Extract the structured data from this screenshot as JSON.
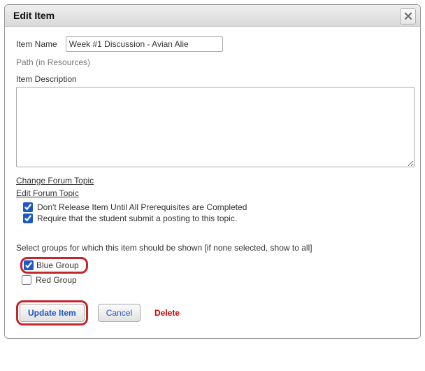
{
  "dialog": {
    "title": "Edit Item"
  },
  "form": {
    "item_name": {
      "label": "Item Name",
      "value": "Week #1 Discussion - Avian Alie"
    },
    "path_label": "Path (in Resources)",
    "description": {
      "label": "Item Description",
      "value": ""
    }
  },
  "links": {
    "change_forum": "Change Forum Topic",
    "edit_forum": "Edit Forum Topic"
  },
  "options": {
    "prereq": "Don't Release Item Until All Prerequisites are Completed",
    "require_post": "Require that the student submit a posting to this topic."
  },
  "groups": {
    "prompt": "Select groups for which this item should be shown [if none selected, show to all]",
    "items": [
      {
        "label": "Blue Group",
        "checked": true
      },
      {
        "label": "Red Group",
        "checked": false
      }
    ]
  },
  "buttons": {
    "update": "Update Item",
    "cancel": "Cancel",
    "delete": "Delete"
  }
}
